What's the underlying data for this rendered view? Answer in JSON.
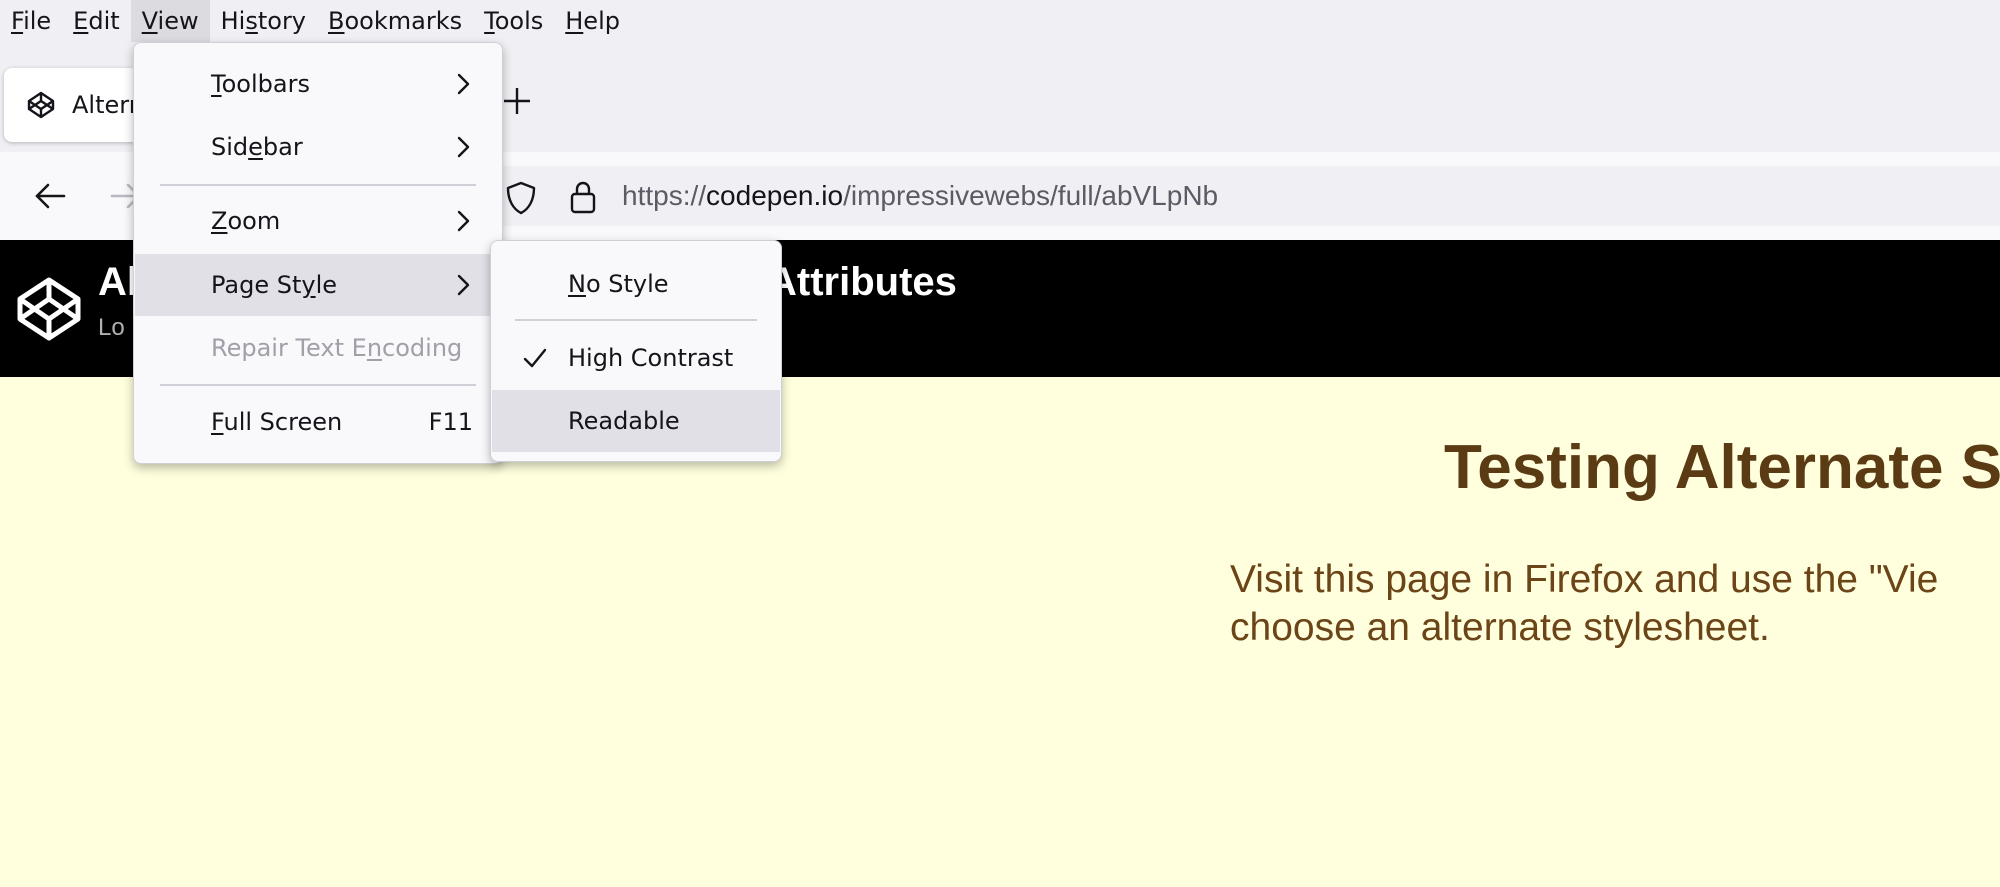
{
  "menubar": {
    "items": [
      {
        "label": "File",
        "u": "F",
        "rest": "ile"
      },
      {
        "label": "Edit",
        "u": "E",
        "rest": "dit"
      },
      {
        "label": "View",
        "u": "V",
        "rest": "iew"
      },
      {
        "label": "History",
        "pre": "Hi",
        "u": "s",
        "rest": "tory"
      },
      {
        "label": "Bookmarks",
        "u": "B",
        "rest": "ookmarks"
      },
      {
        "label": "Tools",
        "u": "T",
        "rest": "ools"
      },
      {
        "label": "Help",
        "u": "H",
        "rest": "elp"
      }
    ]
  },
  "tab": {
    "title": "Altern"
  },
  "address": {
    "scheme": "https://",
    "host": "codepen.io",
    "path": "/impressivewebs/full/abVLpNb"
  },
  "codepen": {
    "title_start": "Al",
    "title_end": "Attributes",
    "subtitle": "Lo"
  },
  "page": {
    "heading": "Testing Alternate S",
    "body_line1": "Visit this page in Firefox and use the \"Vie",
    "body_line2": "choose an alternate stylesheet."
  },
  "view_menu": {
    "toolbars": {
      "u": "T",
      "rest": "oolbars"
    },
    "sidebar": {
      "pre": "Sid",
      "u": "e",
      "rest": "bar"
    },
    "zoom": {
      "u": "Z",
      "rest": "oom"
    },
    "page_style": {
      "pre": "Page St",
      "u": "y",
      "rest": "le"
    },
    "repair": {
      "pre": "Repair Text E",
      "u": "n",
      "rest": "coding"
    },
    "fullscreen": {
      "u": "F",
      "rest": "ull Screen",
      "shortcut": "F11"
    }
  },
  "page_style_menu": {
    "no_style": {
      "u": "N",
      "rest": "o Style"
    },
    "high_contrast": "High Contrast",
    "readable": "Readable"
  },
  "colors": {
    "content_bg": "#ffffdd",
    "header_bg": "#000000",
    "heading": "#5a3b14",
    "body_text": "#6b4418"
  }
}
